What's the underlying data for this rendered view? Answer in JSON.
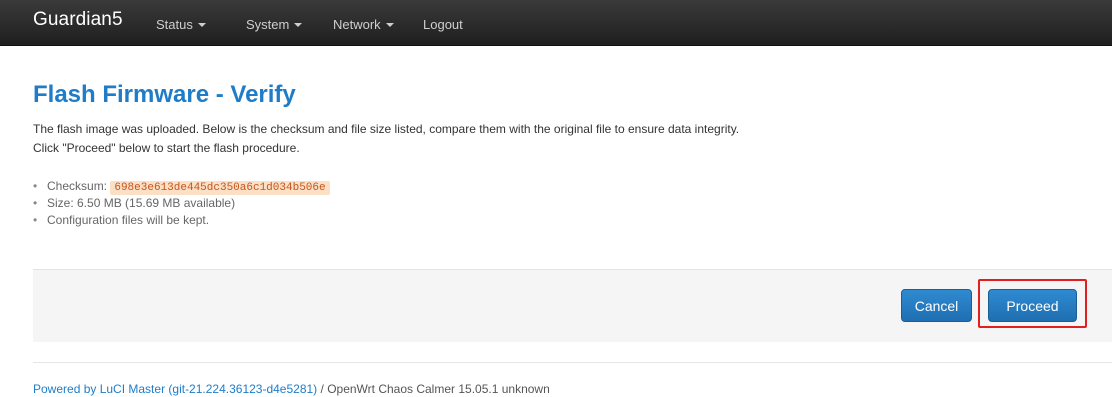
{
  "navbar": {
    "brand": "Guardian5",
    "items": [
      {
        "label": "Status",
        "dropdown": true
      },
      {
        "label": "System",
        "dropdown": true
      },
      {
        "label": "Network",
        "dropdown": true
      },
      {
        "label": "Logout",
        "dropdown": false
      }
    ]
  },
  "page": {
    "title": "Flash Firmware - Verify",
    "description_line1": "The flash image was uploaded. Below is the checksum and file size listed, compare them with the original file to ensure data integrity.",
    "description_line2": "Click \"Proceed\" below to start the flash procedure.",
    "info": {
      "checksum_label": "Checksum: ",
      "checksum_value": "698e3e613de445dc350a6c1d034b506e",
      "size_text": "Size: 6.50 MB (15.69 MB available)",
      "config_text": "Configuration files will be kept."
    }
  },
  "actions": {
    "cancel_label": "Cancel",
    "proceed_label": "Proceed"
  },
  "footer": {
    "link_text": "Powered by LuCI Master (git-21.224.36123-d4e5281)",
    "rest_text": " / OpenWrt Chaos Calmer 15.05.1 unknown"
  },
  "colors": {
    "accent": "#1e7cc8",
    "highlight": "#e02020",
    "checksum_bg": "#fbe0c6"
  }
}
